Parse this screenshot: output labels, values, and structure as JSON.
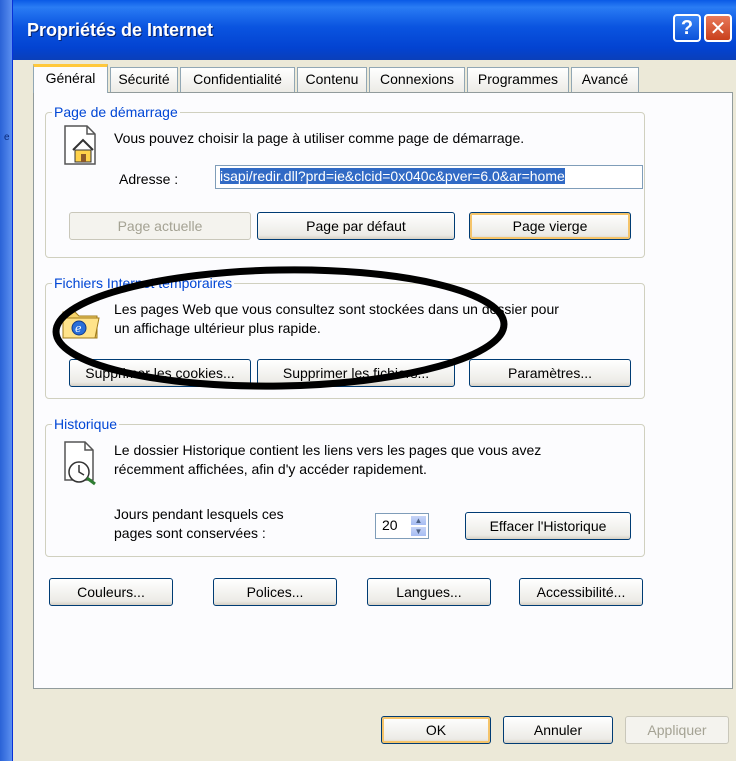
{
  "window": {
    "title": "Propriétés de Internet",
    "help_label": "?",
    "close_label": "✕"
  },
  "tabs": [
    {
      "label": "Général",
      "active": true
    },
    {
      "label": "Sécurité",
      "active": false
    },
    {
      "label": "Confidentialité",
      "active": false
    },
    {
      "label": "Contenu",
      "active": false
    },
    {
      "label": "Connexions",
      "active": false
    },
    {
      "label": "Programmes",
      "active": false
    },
    {
      "label": "Avancé",
      "active": false
    }
  ],
  "home_page": {
    "legend": "Page de démarrage",
    "description": "Vous pouvez choisir la page à utiliser comme page de démarrage.",
    "address_label": "Adresse :",
    "address_value": "isapi/redir.dll?prd=ie&clcid=0x040c&pver=6.0&ar=home",
    "btn_current": "Page actuelle",
    "btn_default": "Page par défaut",
    "btn_blank": "Page vierge"
  },
  "temp_files": {
    "legend": "Fichiers Internet temporaires",
    "description_line1": "Les pages Web que vous consultez sont stockées dans un dossier pour",
    "description_line2": "un affichage ultérieur plus rapide.",
    "btn_delete_cookies": "Supprimer les cookies...",
    "btn_delete_files": "Supprimer les fichiers...",
    "btn_settings": "Paramètres..."
  },
  "history": {
    "legend": "Historique",
    "description_line1": "Le dossier Historique contient les liens vers les pages que vous avez",
    "description_line2": "récemment affichées, afin d'y accéder rapidement.",
    "days_label_line1": "Jours pendant lesquels ces",
    "days_label_line2": "pages sont conservées :",
    "days_value": "20",
    "btn_clear": "Effacer l'Historique"
  },
  "bottom_buttons": {
    "colors": "Couleurs...",
    "fonts": "Polices...",
    "languages": "Langues...",
    "accessibility": "Accessibilité..."
  },
  "dialog_buttons": {
    "ok": "OK",
    "cancel": "Annuler",
    "apply": "Appliquer"
  },
  "colors": {
    "title_bar": "#0a54e0",
    "group_legend": "#0046d5",
    "selection": "#316ac5",
    "annotation": "#000000"
  }
}
